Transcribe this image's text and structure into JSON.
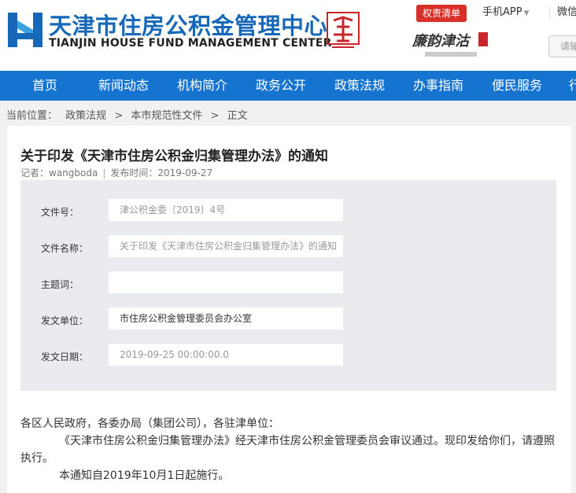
{
  "header": {
    "logo_cn": "天津市住房公积金管理中心",
    "logo_en": "TIANJIN HOUSE FUND MANAGEMENT CENTER",
    "quanze_btn": "权责清单",
    "app_link": "手机APP",
    "wechat_link": "微信",
    "search_placeholder": "请输入",
    "lianyun_text": "廉韵津沽"
  },
  "nav": {
    "items": [
      "首页",
      "新闻动态",
      "机构简介",
      "政务公开",
      "政策法规",
      "办事指南",
      "便民服务",
      "行"
    ]
  },
  "breadcrumb": {
    "label": "当前位置：",
    "items": [
      "政策法规",
      "本市规范性文件",
      "正文"
    ],
    "separator": ">"
  },
  "article": {
    "title": "关于印发《天津市住房公积金归集管理办法》的通知",
    "author": "记者：wangboda",
    "publish_time": "发布时间：2019-09-27",
    "fields": [
      {
        "label": "文件号：",
        "value": "津公积金委〔2019〕4号"
      },
      {
        "label": "文件名称：",
        "value": "关于印发《天津市住房公积金归集管理办法》的通知"
      },
      {
        "label": "主题词：",
        "value": ""
      },
      {
        "label": "发文单位：",
        "value": "市住房公积金管理委员会办公室"
      },
      {
        "label": "发文日期：",
        "value": "2019-09-25 00:00:00.0"
      }
    ],
    "body": [
      "各区人民政府，各委办局（集团公司），各驻津单位：",
      "《天津市住房公积金归集管理办法》经天津市住房公积金管理委员会审议通过。现印发给你们，请遵照执行。",
      "本通知自2019年10月1日起施行。"
    ]
  },
  "colors": {
    "brand_blue": "#1674d1",
    "logo_blue": "#1768b8",
    "accent_red": "#d9302a"
  }
}
